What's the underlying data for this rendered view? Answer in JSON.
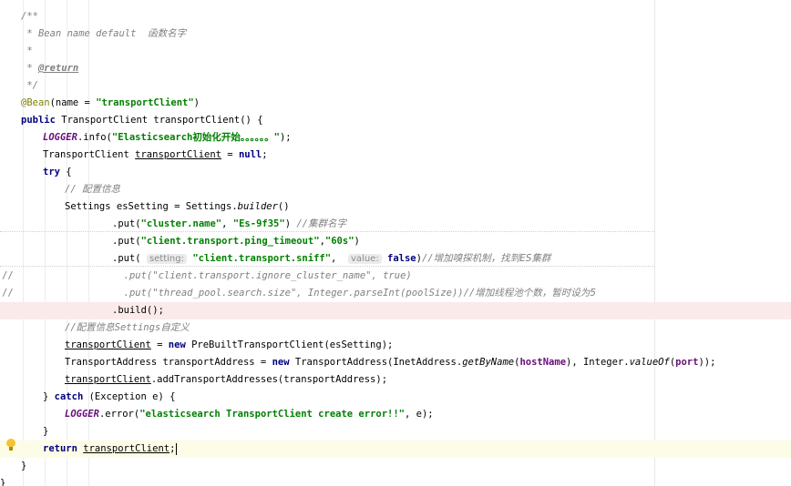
{
  "editor": {
    "lines": [
      {
        "indent": 1,
        "tokens": [
          {
            "c": "cm",
            "t": "/**"
          }
        ]
      },
      {
        "indent": 1,
        "tokens": [
          {
            "c": "cm",
            "t": " * Bean name default  "
          },
          {
            "c": "cm cjk",
            "t": "函数名字"
          }
        ]
      },
      {
        "indent": 1,
        "tokens": [
          {
            "c": "cm",
            "t": " *"
          }
        ]
      },
      {
        "indent": 1,
        "tokens": [
          {
            "c": "cm",
            "t": " * "
          },
          {
            "c": "tag",
            "t": "@return"
          }
        ]
      },
      {
        "indent": 1,
        "tokens": [
          {
            "c": "cm",
            "t": " */"
          }
        ]
      },
      {
        "indent": 1,
        "tokens": [
          {
            "c": "ann",
            "t": "@Bean"
          },
          {
            "c": "",
            "t": "(name = "
          },
          {
            "c": "str",
            "t": "\"transportClient\""
          },
          {
            "c": "",
            "t": ")"
          }
        ]
      },
      {
        "indent": 1,
        "tokens": [
          {
            "c": "kw",
            "t": "public "
          },
          {
            "c": "",
            "t": "TransportClient transportClient() {"
          }
        ]
      },
      {
        "indent": 2,
        "tokens": [
          {
            "c": "const",
            "t": "LOGGER"
          },
          {
            "c": "",
            "t": ".info("
          },
          {
            "c": "str",
            "t": "\"Elasticsearch"
          },
          {
            "c": "str cjk",
            "t": "初始化开始。。。。。。"
          },
          {
            "c": "str",
            "t": "\""
          },
          {
            "c": "",
            "t": ");"
          }
        ]
      },
      {
        "indent": 2,
        "tokens": [
          {
            "c": "",
            "t": "TransportClient "
          },
          {
            "c": "ul",
            "t": "transportClient"
          },
          {
            "c": "",
            "t": " = "
          },
          {
            "c": "kw",
            "t": "null"
          },
          {
            "c": "",
            "t": ";"
          }
        ]
      },
      {
        "indent": 2,
        "tokens": [
          {
            "c": "kw",
            "t": "try "
          },
          {
            "c": "",
            "t": "{"
          }
        ]
      },
      {
        "indent": 3,
        "tokens": [
          {
            "c": "cm",
            "t": "// "
          },
          {
            "c": "cm cjk",
            "t": "配置信息"
          }
        ]
      },
      {
        "indent": 3,
        "tokens": [
          {
            "c": "",
            "t": "Settings esSetting = Settings."
          },
          {
            "c": "sm",
            "t": "builder"
          },
          {
            "c": "",
            "t": "()"
          }
        ]
      },
      {
        "indent": 5,
        "tokens": [
          {
            "c": "",
            "t": ".put("
          },
          {
            "c": "str",
            "t": "\"cluster.name\""
          },
          {
            "c": "",
            "t": ", "
          },
          {
            "c": "str",
            "t": "\"Es-9f35\""
          },
          {
            "c": "",
            "t": ") "
          },
          {
            "c": "cm",
            "t": "//"
          },
          {
            "c": "cm cjk",
            "t": "集群名字"
          }
        ]
      },
      {
        "indent": 5,
        "tokens": [
          {
            "c": "",
            "t": ".put("
          },
          {
            "c": "str",
            "t": "\"client.transport.ping_timeout\""
          },
          {
            "c": "",
            "t": ","
          },
          {
            "c": "str",
            "t": "\"60s\""
          },
          {
            "c": "",
            "t": ")"
          }
        ]
      },
      {
        "indent": 5,
        "tokens": [
          {
            "c": "",
            "t": ".put( "
          },
          {
            "c": "hint",
            "t": "setting:"
          },
          {
            "c": "",
            "t": " "
          },
          {
            "c": "str",
            "t": "\"client.transport.sniff\""
          },
          {
            "c": "",
            "t": ",  "
          },
          {
            "c": "hint",
            "t": "value:"
          },
          {
            "c": "",
            "t": " "
          },
          {
            "c": "kw",
            "t": "false"
          },
          {
            "c": "",
            "t": ")"
          },
          {
            "c": "cm",
            "t": "//"
          },
          {
            "c": "cm cjk",
            "t": "增加嗅探机制，找到ES集群"
          }
        ]
      },
      {
        "indent": 5,
        "slash": "//",
        "tokens": [
          {
            "c": "cm",
            "t": "  .put(\"client.transport.ignore_cluster_name\", true)"
          }
        ]
      },
      {
        "indent": 5,
        "slash": "//",
        "tokens": [
          {
            "c": "cm",
            "t": "  .put(\"thread_pool.search.size\", Integer.parseInt(poolSize))//"
          },
          {
            "c": "cm cjk",
            "t": "增加线程池个数，暂时设为5"
          }
        ]
      },
      {
        "indent": 5,
        "error": true,
        "tokens": [
          {
            "c": "",
            "t": ".build();"
          }
        ]
      },
      {
        "indent": 3,
        "tokens": [
          {
            "c": "cm",
            "t": "//"
          },
          {
            "c": "cm cjk",
            "t": "配置信息"
          },
          {
            "c": "cm",
            "t": "Settings"
          },
          {
            "c": "cm cjk",
            "t": "自定义"
          }
        ]
      },
      {
        "indent": 3,
        "tokens": [
          {
            "c": "ul",
            "t": "transportClient"
          },
          {
            "c": "",
            "t": " = "
          },
          {
            "c": "kw",
            "t": "new "
          },
          {
            "c": "",
            "t": "PreBuiltTransportClient(esSetting);"
          }
        ]
      },
      {
        "indent": 3,
        "tokens": [
          {
            "c": "",
            "t": "TransportAddress transportAddress = "
          },
          {
            "c": "kw",
            "t": "new "
          },
          {
            "c": "",
            "t": "TransportAddress(InetAddress."
          },
          {
            "c": "sm",
            "t": "getByName"
          },
          {
            "c": "",
            "t": "("
          },
          {
            "c": "field",
            "t": "hostName"
          },
          {
            "c": "",
            "t": "), Integer."
          },
          {
            "c": "sm",
            "t": "valueOf"
          },
          {
            "c": "",
            "t": "("
          },
          {
            "c": "field",
            "t": "port"
          },
          {
            "c": "",
            "t": "));"
          }
        ]
      },
      {
        "indent": 3,
        "tokens": [
          {
            "c": "ul",
            "t": "transportClient"
          },
          {
            "c": "",
            "t": ".addTransportAddresses(transportAddress);"
          }
        ]
      },
      {
        "indent": 2,
        "tokens": [
          {
            "c": "",
            "t": "} "
          },
          {
            "c": "kw",
            "t": "catch "
          },
          {
            "c": "",
            "t": "(Exception e) {"
          }
        ]
      },
      {
        "indent": 3,
        "tokens": [
          {
            "c": "const",
            "t": "LOGGER"
          },
          {
            "c": "",
            "t": ".error("
          },
          {
            "c": "str",
            "t": "\"elasticsearch TransportClient create error!!\""
          },
          {
            "c": "",
            "t": ", e);"
          }
        ]
      },
      {
        "indent": 2,
        "tokens": [
          {
            "c": "",
            "t": "}"
          }
        ]
      },
      {
        "indent": 2,
        "current": true,
        "caret": true,
        "tokens": [
          {
            "c": "kw",
            "t": "return "
          },
          {
            "c": "ul",
            "t": "transportClient"
          },
          {
            "c": "",
            "t": ";"
          }
        ]
      },
      {
        "indent": 1,
        "tokens": [
          {
            "c": "",
            "t": "}"
          }
        ]
      },
      {
        "indent": 0,
        "tokens": [
          {
            "c": "",
            "t": "}"
          }
        ]
      }
    ]
  }
}
